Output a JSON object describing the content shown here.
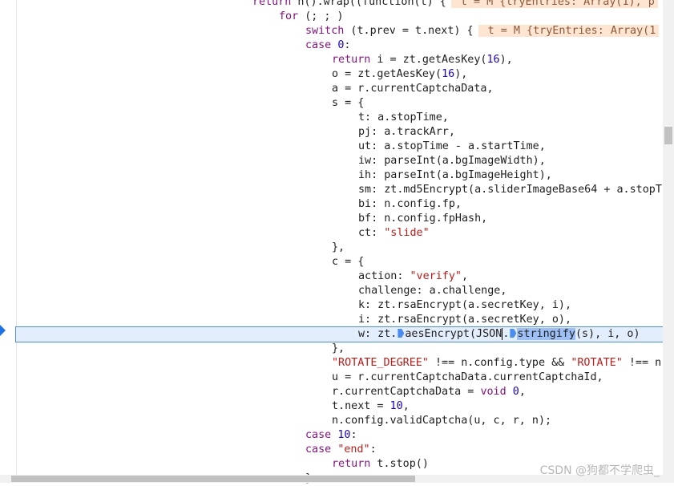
{
  "editor": {
    "lines": [
      {
        "indent": 9,
        "tokens": [
          {
            "t": "return",
            "c": "kw"
          },
          {
            "t": " n().wrap((function(t) {"
          },
          {
            "t": " t = M {tryEntries: Array(1), p",
            "c": "inline"
          }
        ]
      },
      {
        "indent": 10,
        "tokens": [
          {
            "t": "for",
            "c": "kw"
          },
          {
            "t": " (; ; )"
          }
        ]
      },
      {
        "indent": 11,
        "tokens": [
          {
            "t": "switch",
            "c": "kw"
          },
          {
            "t": " (t.prev = t.next) {"
          },
          {
            "t": " t = M {tryEntries: Array(1",
            "c": "inline"
          }
        ]
      },
      {
        "indent": 11,
        "tokens": [
          {
            "t": "case",
            "c": "kw"
          },
          {
            "t": " "
          },
          {
            "t": "0",
            "c": "num"
          },
          {
            "t": ":"
          }
        ]
      },
      {
        "indent": 12,
        "tokens": [
          {
            "t": "return",
            "c": "kw"
          },
          {
            "t": " i = zt.getAesKey("
          },
          {
            "t": "16",
            "c": "num"
          },
          {
            "t": "),"
          }
        ]
      },
      {
        "indent": 12,
        "tokens": [
          {
            "t": "o = zt.getAesKey("
          },
          {
            "t": "16",
            "c": "num"
          },
          {
            "t": "),"
          }
        ]
      },
      {
        "indent": 12,
        "tokens": [
          {
            "t": "a = r.currentCaptchaData,"
          }
        ]
      },
      {
        "indent": 12,
        "tokens": [
          {
            "t": "s = {"
          }
        ]
      },
      {
        "indent": 13,
        "tokens": [
          {
            "t": "t: a.stopTime,"
          }
        ]
      },
      {
        "indent": 13,
        "tokens": [
          {
            "t": "pj: a.trackArr,"
          }
        ]
      },
      {
        "indent": 13,
        "tokens": [
          {
            "t": "ut: a.stopTime - a.startTime,"
          }
        ]
      },
      {
        "indent": 13,
        "tokens": [
          {
            "t": "iw: parseInt(a.bgImageWidth),"
          }
        ]
      },
      {
        "indent": 13,
        "tokens": [
          {
            "t": "ih: parseInt(a.bgImageHeight),"
          }
        ]
      },
      {
        "indent": 13,
        "tokens": [
          {
            "t": "sm: zt.md5Encrypt(a.sliderImageBase64 + a.stopT"
          }
        ]
      },
      {
        "indent": 13,
        "tokens": [
          {
            "t": "bi: n.config.fp,"
          }
        ]
      },
      {
        "indent": 13,
        "tokens": [
          {
            "t": "bf: n.config.fpHash,"
          }
        ]
      },
      {
        "indent": 13,
        "tokens": [
          {
            "t": "ct: "
          },
          {
            "t": "\"slide\"",
            "c": "str"
          }
        ]
      },
      {
        "indent": 12,
        "tokens": [
          {
            "t": "},"
          }
        ]
      },
      {
        "indent": 12,
        "tokens": [
          {
            "t": "c = {"
          }
        ]
      },
      {
        "indent": 13,
        "tokens": [
          {
            "t": "action: "
          },
          {
            "t": "\"verify\"",
            "c": "str"
          },
          {
            "t": ","
          }
        ]
      },
      {
        "indent": 13,
        "tokens": [
          {
            "t": "challenge: a.challenge,"
          }
        ]
      },
      {
        "indent": 13,
        "tokens": [
          {
            "t": "k: zt.rsaEncrypt(a.secretKey, i),"
          }
        ]
      },
      {
        "indent": 13,
        "tokens": [
          {
            "t": "i: zt.rsaEncrypt(a.secretKey, o),"
          }
        ]
      },
      {
        "indent": 13,
        "current": true,
        "tokens": [
          {
            "t": "w: zt."
          },
          {
            "t": "",
            "c": "step"
          },
          {
            "t": "aesEncrypt(JSON"
          },
          {
            "t": ".",
            "c": "caret"
          },
          {
            "t": "",
            "c": "step"
          },
          {
            "t": "stringify",
            "c": "sel"
          },
          {
            "t": "(s), i, o)"
          }
        ]
      },
      {
        "indent": 12,
        "tokens": [
          {
            "t": "},"
          }
        ]
      },
      {
        "indent": 12,
        "tokens": [
          {
            "t": "\"ROTATE_DEGREE\"",
            "c": "str"
          },
          {
            "t": " !== n.config.type && "
          },
          {
            "t": "\"ROTATE\"",
            "c": "str"
          },
          {
            "t": " !== n"
          }
        ]
      },
      {
        "indent": 12,
        "tokens": [
          {
            "t": "u = r.currentCaptchaData.currentCaptchaId,"
          }
        ]
      },
      {
        "indent": 12,
        "tokens": [
          {
            "t": "r.currentCaptchaData = "
          },
          {
            "t": "void",
            "c": "kw"
          },
          {
            "t": " "
          },
          {
            "t": "0",
            "c": "num"
          },
          {
            "t": ","
          }
        ]
      },
      {
        "indent": 12,
        "tokens": [
          {
            "t": "t.next = "
          },
          {
            "t": "10",
            "c": "num"
          },
          {
            "t": ","
          }
        ]
      },
      {
        "indent": 12,
        "tokens": [
          {
            "t": "n.config.validCaptcha(u, c, r, n);"
          }
        ]
      },
      {
        "indent": 11,
        "tokens": [
          {
            "t": "case",
            "c": "kw"
          },
          {
            "t": " "
          },
          {
            "t": "10",
            "c": "num"
          },
          {
            "t": ":"
          }
        ]
      },
      {
        "indent": 11,
        "tokens": [
          {
            "t": "case",
            "c": "kw"
          },
          {
            "t": " "
          },
          {
            "t": "\"end\"",
            "c": "str"
          },
          {
            "t": ":"
          }
        ]
      },
      {
        "indent": 12,
        "tokens": [
          {
            "t": "return",
            "c": "kw"
          },
          {
            "t": " t.stop()"
          }
        ]
      },
      {
        "indent": 11,
        "tokens": [
          {
            "t": "}"
          }
        ]
      }
    ]
  },
  "watermark": "CSDN @狗都不学爬虫_"
}
